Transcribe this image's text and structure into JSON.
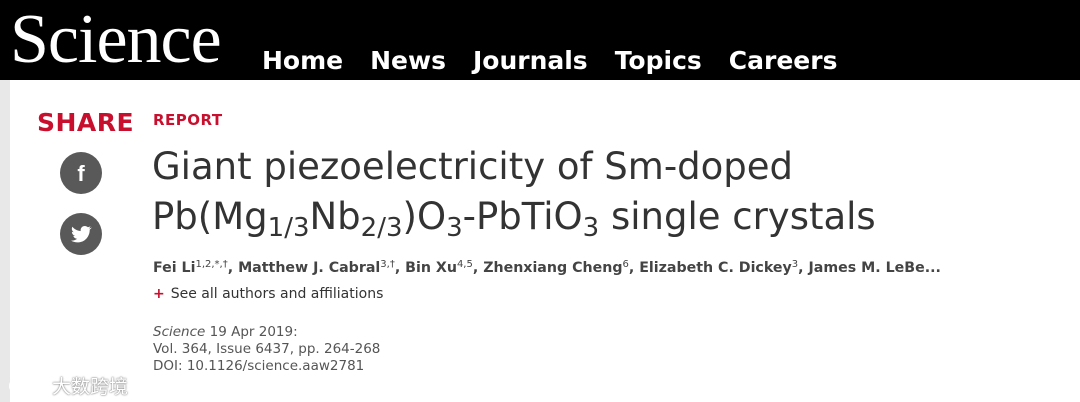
{
  "header": {
    "logo": "Science",
    "nav": [
      "Home",
      "News",
      "Journals",
      "Topics",
      "Careers"
    ]
  },
  "share": {
    "label": "SHARE",
    "buttons": [
      {
        "icon": "facebook-icon",
        "glyph": "f"
      },
      {
        "icon": "twitter-icon"
      }
    ]
  },
  "article": {
    "type": "REPORT",
    "title_line1": "Giant piezoelectricity of Sm-doped",
    "title_line2": {
      "pre": "Pb(Mg",
      "sub1": "1/3",
      "mid": "Nb",
      "sub2": "2/3",
      "o3a": ")O",
      "sub3": "3",
      "mid2": "-PbTiO",
      "sub4": "3",
      "post": " single crystals"
    },
    "authors": [
      {
        "name": "Fei Li",
        "sup": "1,2,*,†",
        "sep": ", "
      },
      {
        "name": "Matthew J. Cabral",
        "sup": "3,†",
        "sep": ", "
      },
      {
        "name": "Bin Xu",
        "sup": "4,5",
        "sep": ", "
      },
      {
        "name": "Zhenxiang Cheng",
        "sup": "6",
        "sep": ", "
      },
      {
        "name": "Elizabeth C. Dickey",
        "sup": "3",
        "sep": ", "
      },
      {
        "name": "James M. LeBe...",
        "sup": "",
        "sep": ""
      }
    ],
    "see_all": {
      "plus": "+",
      "label": "See all authors and affiliations"
    },
    "citation": {
      "journal": "Science",
      "date": " 19 Apr 2019:",
      "volume": "Vol. 364, Issue 6437, pp. 264-268",
      "doi": "DOI: 10.1126/science.aaw2781"
    }
  },
  "watermark": {
    "text": "大数跨境"
  },
  "colors": {
    "accent": "#c8102e",
    "topbar": "#000000",
    "icon_bg": "#595959"
  }
}
